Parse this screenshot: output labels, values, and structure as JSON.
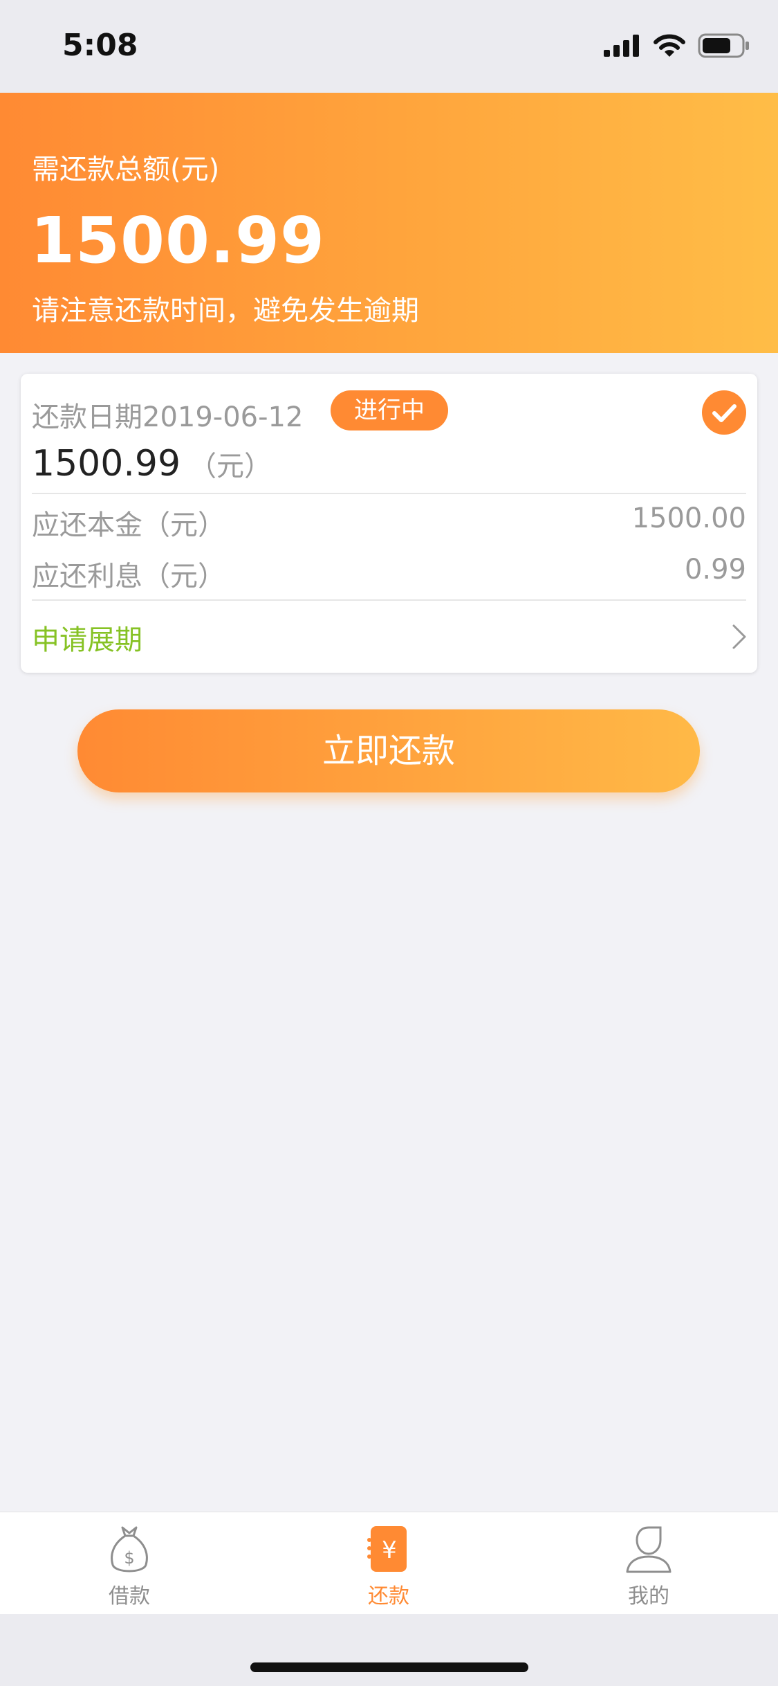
{
  "status_bar": {
    "time": "5:08"
  },
  "summary": {
    "label": "需还款总额(元)",
    "amount": "1500.99",
    "tip": "请注意还款时间，避免发生逾期"
  },
  "bill": {
    "date_label": "还款日期2019-06-12",
    "status": "进行中",
    "amount": "1500.99",
    "unit": "（元）",
    "rows": [
      {
        "label": "应还本金（元）",
        "value": "1500.00"
      },
      {
        "label": "应还利息（元）",
        "value": "0.99"
      }
    ],
    "extend_label": "申请展期"
  },
  "actions": {
    "pay_now": "立即还款"
  },
  "tabbar": {
    "items": [
      {
        "label": "借款",
        "icon": "money-bag-icon"
      },
      {
        "label": "还款",
        "icon": "repay-yen-icon",
        "active": true
      },
      {
        "label": "我的",
        "icon": "person-icon"
      }
    ]
  },
  "colors": {
    "accent": "#ff8a33",
    "accent_light": "#ffbd47",
    "link_green": "#86c224"
  }
}
